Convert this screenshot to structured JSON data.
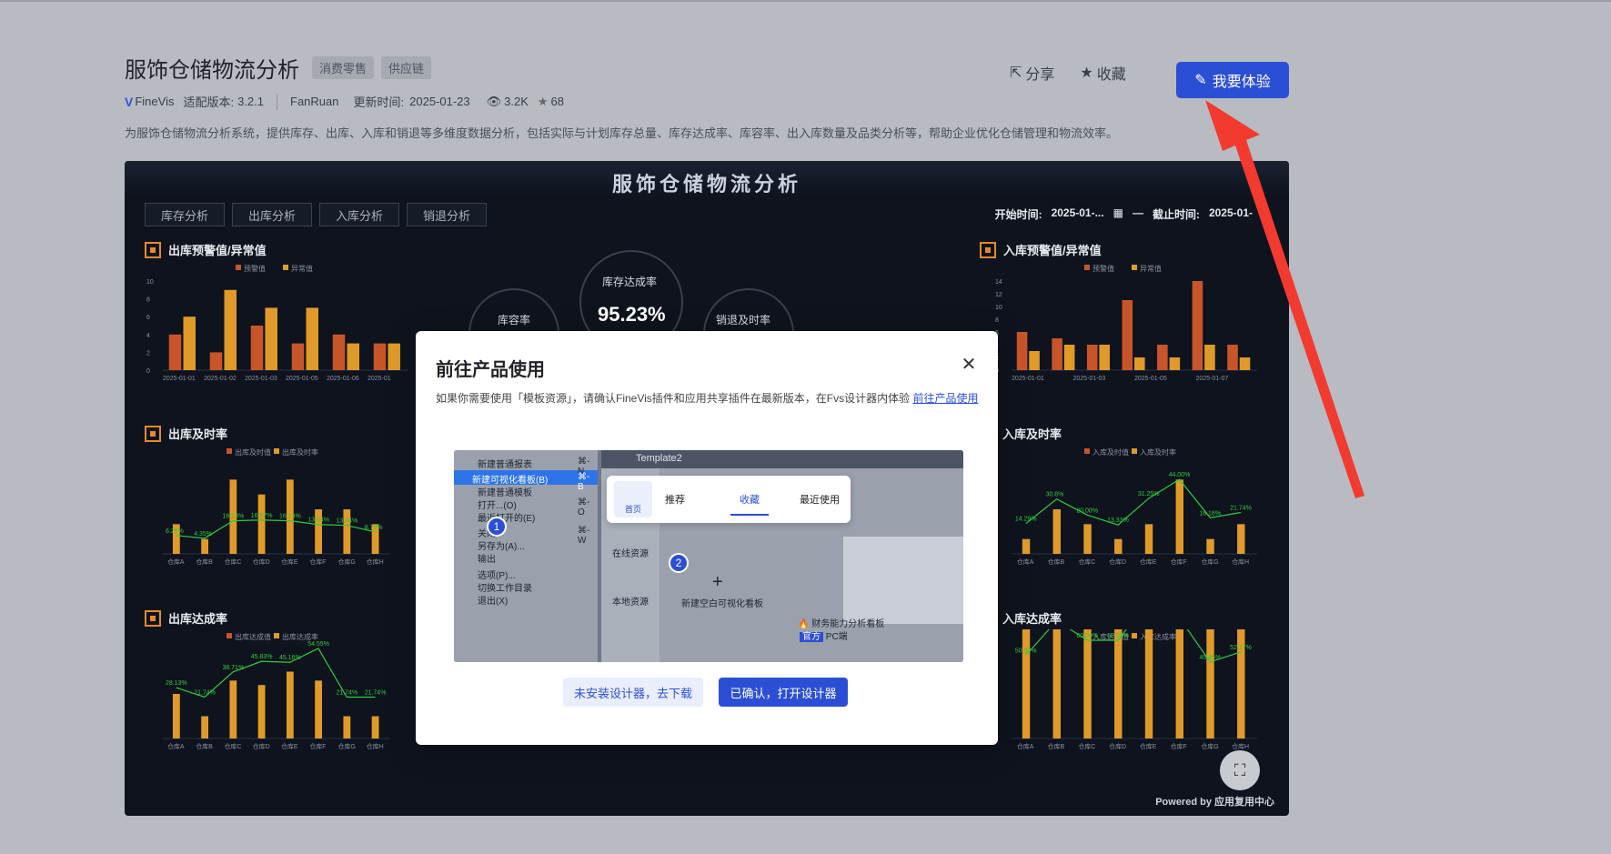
{
  "header": {
    "title": "服饰仓储物流分析",
    "tags": [
      "消费零售",
      "供应链"
    ],
    "brand": "FineVis",
    "version_label": "适配版本:",
    "version": "3.2.1",
    "author": "FanRuan",
    "updated_label": "更新时间:",
    "updated": "2025-01-23",
    "views": "3.2K",
    "stars": "68",
    "description": "为服饰仓储物流分析系统，提供库存、出库、入库和销退等多维度数据分析，包括实际与计划库存总量、库存达成率、库容率、出入库数量及品类分析等，帮助企业优化仓储管理和物流效率。"
  },
  "actions": {
    "share": "分享",
    "favorite": "收藏",
    "try": "我要体验"
  },
  "dashboard": {
    "title": "服饰仓储物流分析",
    "tabs": [
      "库存分析",
      "出库分析",
      "入库分析",
      "销退分析"
    ],
    "start_label": "开始时间:",
    "start_value": "2025-01-...",
    "end_label": "截止时间:",
    "end_value": "2025-01-",
    "sections": {
      "out_warning": "出库预警值/异常值",
      "in_warning": "入库预警值/异常值",
      "out_timely": "出库及时率",
      "in_timely": "入库及时率",
      "out_rate": "出库达成率",
      "in_rate": "入库达成率"
    },
    "kpi": {
      "stock_rate_label": "库存达成率",
      "stock_rate_value": "95.23%",
      "capacity_label": "库容率",
      "sales_return_label": "销退及时率"
    },
    "powered": "Powered by 应用复用中心"
  },
  "chart_data": [
    {
      "type": "bar",
      "title": "出库预警值/异常值",
      "legend": [
        "预警值",
        "异常值"
      ],
      "categories": [
        "2025-01-01",
        "2025-01-02",
        "2025-01-03",
        "2025-01-05",
        "2025-01-06",
        "2025-01"
      ],
      "series": [
        {
          "name": "预警值",
          "values": [
            4,
            2,
            5,
            3,
            4,
            3
          ]
        },
        {
          "name": "异常值",
          "values": [
            6,
            9,
            7,
            7,
            3,
            3
          ]
        }
      ],
      "ylim": [
        0,
        10
      ],
      "yticks": [
        0,
        2,
        4,
        6,
        8,
        10
      ]
    },
    {
      "type": "bar",
      "title": "入库预警值/异常值",
      "legend": [
        "预警值",
        "异常值"
      ],
      "categories": [
        "2025-01-01",
        "2025-01-03",
        "2025-01-05",
        "2025-01-07"
      ],
      "series": [
        {
          "name": "预警值",
          "values": [
            6,
            5,
            4,
            11,
            4,
            14,
            4
          ]
        },
        {
          "name": "异常值",
          "values": [
            3,
            4,
            4,
            2,
            2,
            4,
            2
          ]
        }
      ],
      "ylim": [
        0,
        14
      ],
      "yticks": [
        0,
        2,
        4,
        6,
        8,
        10,
        12,
        14
      ]
    },
    {
      "type": "bar",
      "title": "出库及时率",
      "legend": [
        "出库及时值",
        "出库及时率"
      ],
      "categories": [
        "仓库A",
        "仓库B",
        "仓库C",
        "仓库D",
        "仓库E",
        "仓库F",
        "仓库G",
        "仓库H"
      ],
      "values": [
        2,
        1,
        5,
        4,
        5,
        3,
        3,
        2
      ],
      "rates": [
        "6.25%",
        "4.35%",
        "16.13%",
        "16.67%",
        "16.13%",
        "13.64%",
        "13.04%",
        "8.70%"
      ],
      "ylim": [
        0,
        6
      ]
    },
    {
      "type": "bar",
      "title": "入库及时率",
      "legend": [
        "入库及时值",
        "入库及时率"
      ],
      "categories": [
        "仓库A",
        "仓库B",
        "仓库C",
        "仓库D",
        "仓库E",
        "仓库F",
        "仓库G",
        "仓库H"
      ],
      "values": [
        1,
        3,
        2,
        1,
        2,
        5,
        1,
        2
      ],
      "rates": [
        "14.29%",
        "30.8%",
        "20.00%",
        "13.33%",
        "31.25%",
        "44.00%",
        "18.18%",
        "21.74%"
      ],
      "ylim": [
        0,
        6
      ]
    },
    {
      "type": "bar",
      "title": "出库达成率",
      "legend": [
        "出库达成值",
        "出库达成率"
      ],
      "categories": [
        "仓库A",
        "仓库B",
        "仓库C",
        "仓库D",
        "仓库E",
        "仓库F",
        "仓库G",
        "仓库H"
      ],
      "values": [
        10,
        5,
        13,
        12,
        15,
        13,
        5,
        5
      ],
      "rates": [
        "28.13%",
        "21.74%",
        "38.71%",
        "45.83%",
        "45.16%",
        "54.55%",
        "21.74%",
        "21.74%"
      ],
      "ylim": [
        0,
        20
      ]
    },
    {
      "type": "bar",
      "title": "入库达成率",
      "legend": [
        "入库达成值",
        "入库达成率"
      ],
      "categories": [
        "仓库A",
        "仓库B",
        "仓库C",
        "仓库D",
        "仓库E",
        "仓库F",
        "仓库G",
        "仓库H"
      ],
      "values": [
        3,
        7,
        5,
        4,
        6,
        8,
        2,
        5
      ],
      "rates": [
        "50.00%",
        "73.16%",
        "60.00%",
        "60.00%",
        "87.50%",
        "75.00%",
        "45.45%",
        "52.17%"
      ],
      "ylim": [
        0,
        1
      ]
    }
  ],
  "modal": {
    "title": "前往产品使用",
    "desc_prefix": "如果你需要使用「模板资源」，请确认FineVis插件和应用共享插件在最新版本，在Fvs设计器内体验",
    "desc_link": "前往产品使用",
    "preview": {
      "menu_items": [
        "新建普通报表",
        "新建可视化看板(B)",
        "新建普通模板",
        "打开...(O)",
        "最近打开的(E)",
        "关闭",
        "另存为(A)...",
        "输出",
        "选项(P)...",
        "切换工作目录",
        "退出(X)"
      ],
      "menu_keys": [
        "⌘-N",
        "⌘-B",
        "",
        "⌘-O",
        "",
        "⌘-W",
        "",
        "",
        "",
        "",
        ""
      ],
      "tab_name": "Template2",
      "popup_tabs": [
        "首页",
        "推荐",
        "收藏",
        "最近使用"
      ],
      "side_items": [
        "在线资源",
        "本地资源"
      ],
      "new_blank": "新建空白可视化看板",
      "thumb_title": "财务能力分析看板",
      "thumb_tags": [
        "官方",
        "PC端"
      ],
      "steps": [
        "1",
        "2"
      ]
    },
    "btn_secondary": "未安装设计器，去下载",
    "btn_primary": "已确认，打开设计器"
  }
}
